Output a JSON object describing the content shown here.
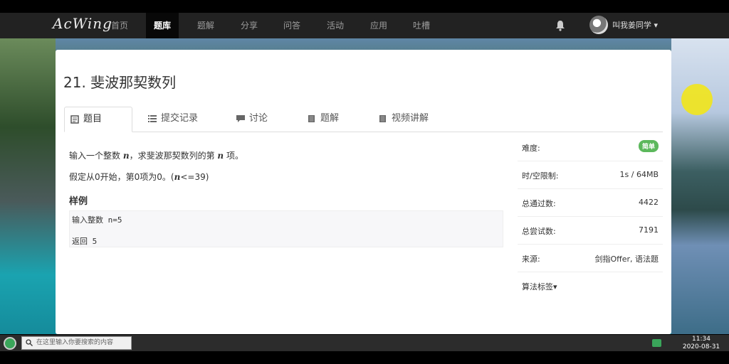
{
  "navbar": {
    "logo": "AcWing",
    "items": [
      "首页",
      "题库",
      "题解",
      "分享",
      "问答",
      "活动",
      "应用",
      "吐槽"
    ],
    "active": "题库",
    "username": "叫我姜同学 ▾"
  },
  "problem": {
    "title": "21. 斐波那契数列",
    "tabs": [
      "题目",
      "提交记录",
      "讨论",
      "题解",
      "视频讲解"
    ],
    "desc_before": "输入一个整数 ",
    "desc_var": "n",
    "desc_mid": "，求斐波那契数列的第 ",
    "desc_after": " 项。",
    "assume_before": "假定从0开始，第0项为0。(",
    "assume_var": "n",
    "assume_after": "<=39)",
    "sample_heading": "样例",
    "sample_input": "输入整数 n=5",
    "sample_output": "返回 5"
  },
  "sidebar": {
    "difficulty_label": "难度:",
    "difficulty_value": "简单",
    "limit_label": "时/空限制:",
    "limit_value": "1s / 64MB",
    "passed_label": "总通过数:",
    "passed_value": "4422",
    "attempts_label": "总尝试数:",
    "attempts_value": "7191",
    "source_label": "来源:",
    "source_value": "剑指Offer, 语法题",
    "tags_label": "算法标签▾"
  },
  "taskbar": {
    "search_placeholder": "在这里输入你要搜索的内容",
    "time": "11:34",
    "date": "2020-08-31"
  },
  "colors": {
    "navbar": "#222222",
    "badge": "#5cb85c"
  }
}
